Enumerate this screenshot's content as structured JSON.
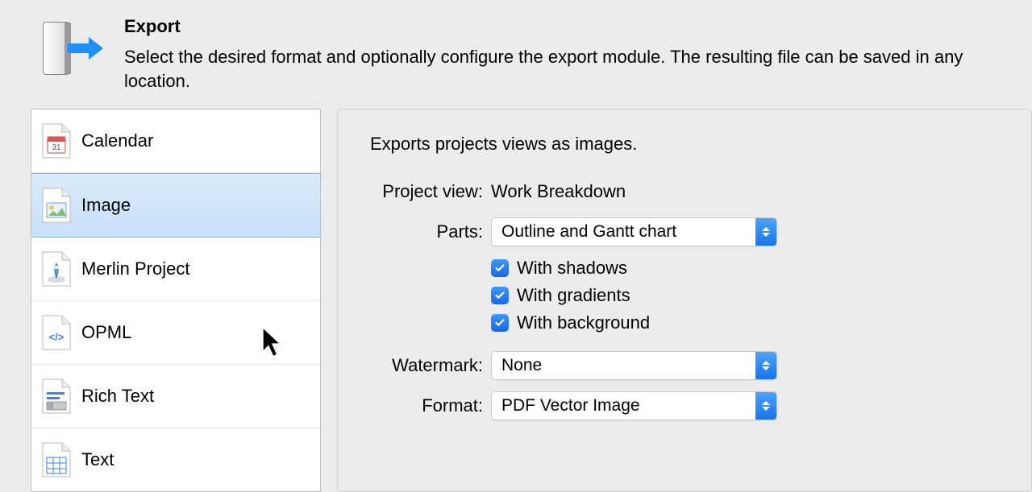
{
  "header": {
    "title": "Export",
    "description": "Select the desired format and optionally configure the export module. The resulting file can be saved in any location."
  },
  "sidebar": {
    "items": [
      {
        "label": "Calendar"
      },
      {
        "label": "Image"
      },
      {
        "label": "Merlin Project"
      },
      {
        "label": "OPML"
      },
      {
        "label": "Rich Text"
      },
      {
        "label": "Text"
      }
    ]
  },
  "panel": {
    "description": "Exports projects views as images.",
    "project_view_label": "Project view:",
    "project_view_value": "Work Breakdown",
    "parts_label": "Parts:",
    "parts_value": "Outline and Gantt chart",
    "checkbox_shadows": "With shadows",
    "checkbox_gradients": "With gradients",
    "checkbox_background": "With background",
    "watermark_label": "Watermark:",
    "watermark_value": "None",
    "format_label": "Format:",
    "format_value": "PDF Vector Image"
  }
}
